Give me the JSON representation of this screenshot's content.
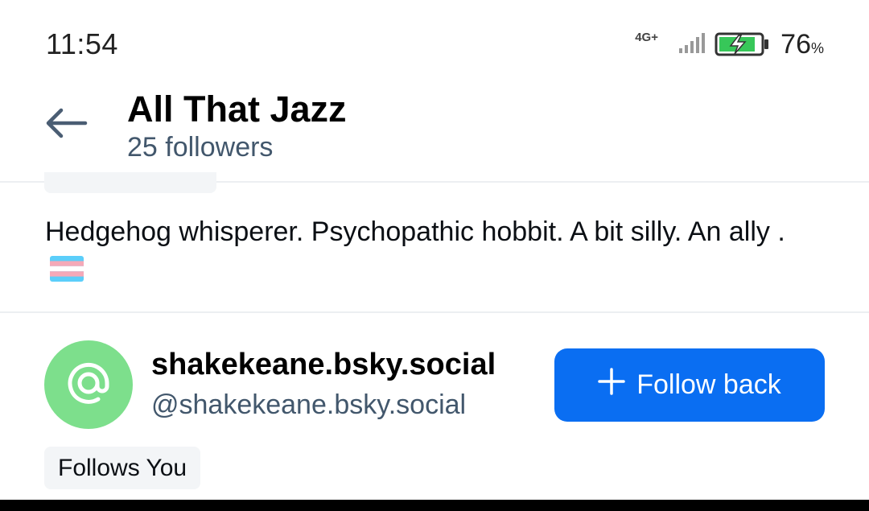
{
  "status_bar": {
    "time": "11:54",
    "network": "4G+",
    "battery_percent": "76",
    "battery_sign": "%"
  },
  "header": {
    "back_icon": "arrow-left-icon",
    "title": "All That Jazz",
    "subtitle": "25 followers"
  },
  "bio": {
    "text": "Hedgehog whisperer. Psychopathic hobbit. A bit silly. An ally .",
    "emoji_icon": "transgender-flag-icon"
  },
  "user": {
    "avatar_icon": "at-sign-icon",
    "avatar_color": "#7ddf8c",
    "display_name": "shakekeane.bsky.social",
    "handle": "@shakekeane.bsky.social",
    "follows_you_label": "Follows You"
  },
  "follow_button": {
    "label": "Follow back",
    "icon": "plus-icon",
    "color": "#0a6ef2"
  }
}
